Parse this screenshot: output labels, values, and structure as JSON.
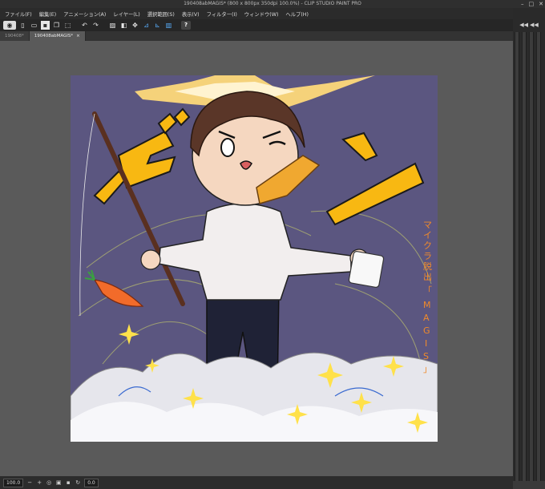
{
  "window": {
    "title": "190408abMAGIS* (800 x 800px 350dpi 100.0%) - CLIP STUDIO PAINT PRO",
    "controls": [
      "–",
      "□",
      "✕"
    ]
  },
  "menu": [
    "ファイル(F)",
    "編集(E)",
    "アニメーション(A)",
    "レイヤー(L)",
    "選択範囲(S)",
    "表示(V)",
    "フィルター(I)",
    "ウィンドウ(W)",
    "ヘルプ(H)"
  ],
  "toolbar": {
    "help_label": "?"
  },
  "tabs": [
    {
      "label": "190408*"
    },
    {
      "label": "190408abMAGIS*",
      "close": "×"
    }
  ],
  "artwork": {
    "side_text": [
      "マ",
      "イ",
      "ク",
      "ラ",
      "脱",
      "出",
      "「",
      "M",
      "A",
      "G",
      "I",
      "S",
      "」"
    ]
  },
  "status": {
    "zoom": "100.0",
    "angle": "0.0"
  },
  "colors": {
    "canvas_bg": "#5b5680",
    "accent_yellow": "#f8b812"
  }
}
